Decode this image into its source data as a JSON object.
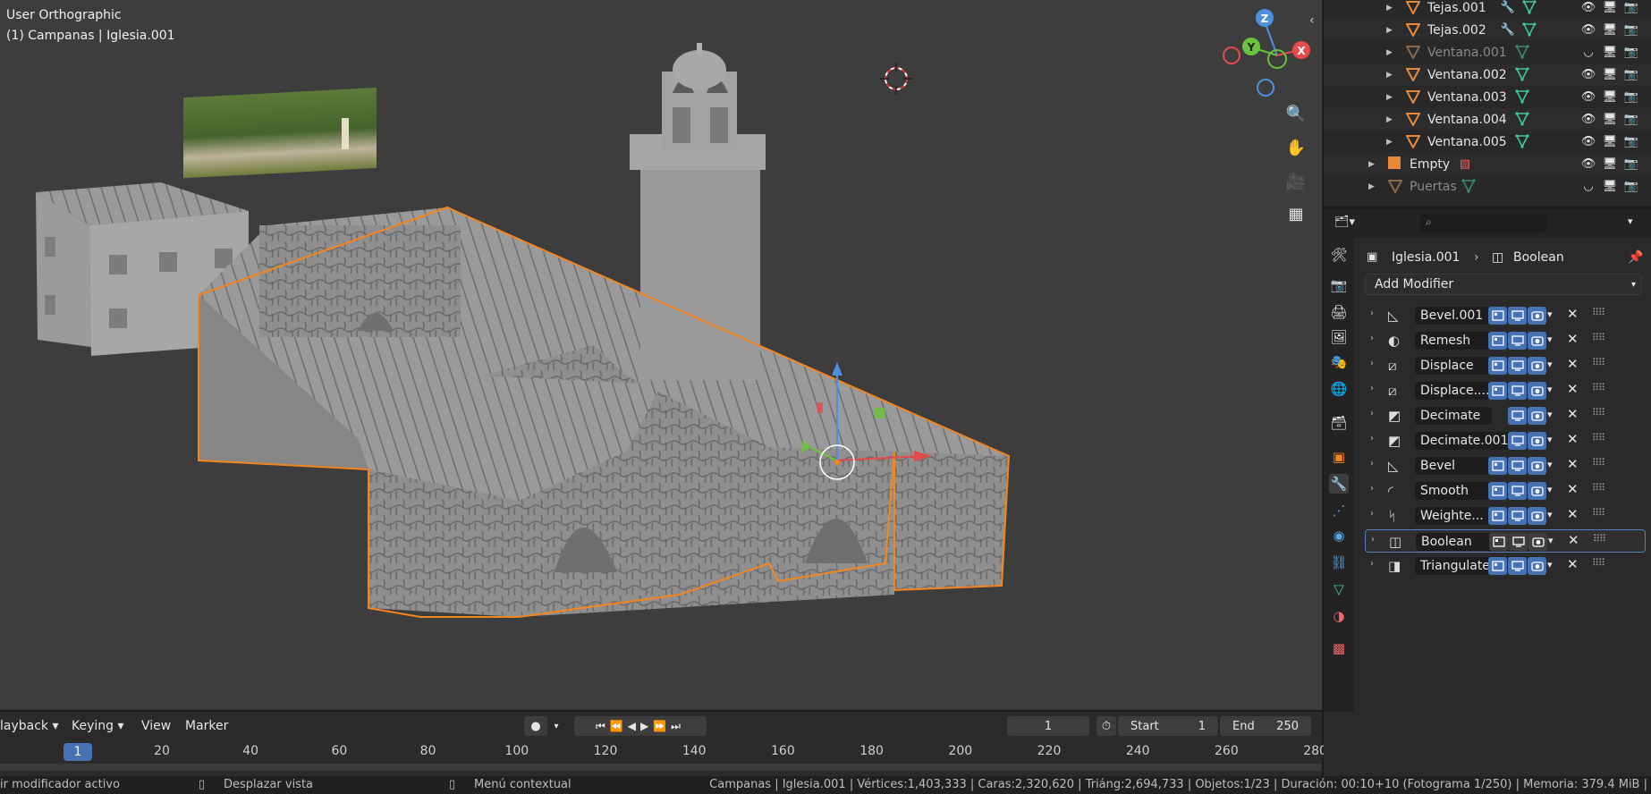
{
  "viewport": {
    "view_name": "User Orthographic",
    "object_info": "(1) Campanas | Iglesia.001",
    "gizmo": {
      "z": "Z",
      "y": "Y",
      "x": "X"
    }
  },
  "outliner": {
    "rows": [
      {
        "name": "Tejas.001",
        "dim": false
      },
      {
        "name": "Tejas.002",
        "dim": false
      },
      {
        "name": "Ventana.001",
        "dim": true
      },
      {
        "name": "Ventana.002",
        "dim": false
      },
      {
        "name": "Ventana.003",
        "dim": false
      },
      {
        "name": "Ventana.004",
        "dim": false
      },
      {
        "name": "Ventana.005",
        "dim": false
      },
      {
        "name": "Empty",
        "dim": false
      },
      {
        "name": "Puertas",
        "dim": true
      }
    ]
  },
  "properties": {
    "object_name": "Iglesia.001",
    "modifier_name": "Boolean",
    "add_modifier": "Add Modifier",
    "modifiers": [
      {
        "name": "Bevel.001"
      },
      {
        "name": "Remesh"
      },
      {
        "name": "Displace"
      },
      {
        "name": "Displace...."
      },
      {
        "name": "Decimate"
      },
      {
        "name": "Decimate.001"
      },
      {
        "name": "Bevel"
      },
      {
        "name": "Smooth"
      },
      {
        "name": "Weighte..."
      },
      {
        "name": "Boolean"
      },
      {
        "name": "Triangulate"
      }
    ]
  },
  "timeline": {
    "menus": [
      "layback",
      "Keying",
      "View",
      "Marker"
    ],
    "current_frame": "1",
    "start_label": "Start",
    "start_value": "1",
    "end_label": "End",
    "end_value": "250",
    "ticks": [
      "1",
      "20",
      "40",
      "60",
      "80",
      "100",
      "120",
      "140",
      "160",
      "180",
      "200",
      "220",
      "240",
      "260",
      "280"
    ]
  },
  "statusbar": {
    "left": "ir modificador activo",
    "middle": "Desplazar vista",
    "context": "Menú contextual",
    "info": "Campanas | Iglesia.001 | Vértices:1,403,333 | Caras:2,320,620 | Triáng:2,694,733 | Objetos:1/23 | Duración: 00:10+10 (Fotograma 1/250) | Memoria: 379.4 MiB |"
  },
  "colors": {
    "accent": "#4772b3",
    "selection": "#f5851f",
    "mesh_icon": "#e88a3a",
    "modifier_icon": "#5ba4e6",
    "data_icon": "#3fc7a0"
  }
}
